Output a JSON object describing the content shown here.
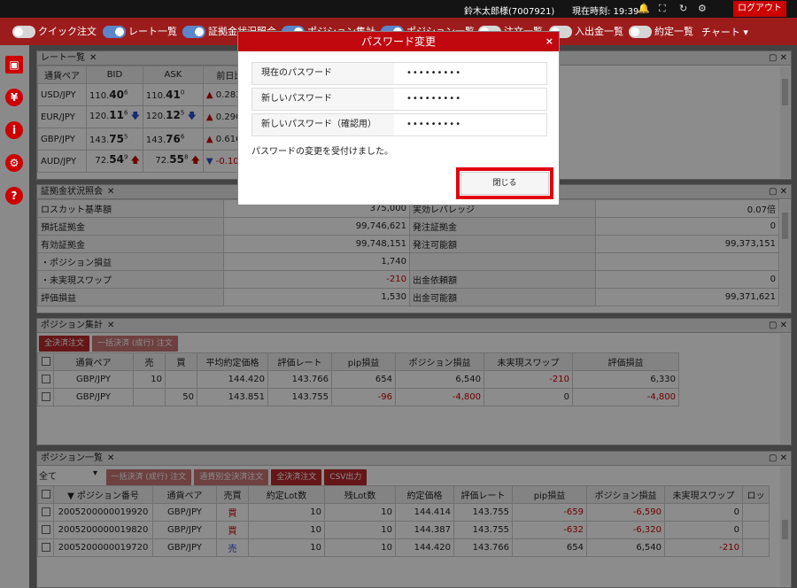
{
  "topbar": {
    "user": "鈴木太郎様(7007921)",
    "time": "現在時刻: 19:39",
    "logout": "ログアウト"
  },
  "toolbar": {
    "items": [
      "クイック注文",
      "レート一覧",
      "証拠金状況照会",
      "ポジション集計",
      "ポジション一覧",
      "注文一覧",
      "入出金一覧",
      "約定一覧"
    ],
    "chart": "チャート"
  },
  "rates": {
    "title": "レート一覧",
    "headers": [
      "通貨ペア",
      "BID",
      "ASK",
      "前日比"
    ],
    "rows": [
      {
        "pair": "USD/JPY",
        "bid_a": "110.",
        "bid_b": "40",
        "bid_c": "6",
        "ask_a": "110.",
        "ask_b": "41",
        "ask_c": "0",
        "chg": "0.283"
      },
      {
        "pair": "EUR/JPY",
        "bid_a": "120.",
        "bid_b": "11",
        "bid_c": "6",
        "ask_a": "120.",
        "ask_b": "12",
        "ask_c": "5",
        "chg": "0.290"
      },
      {
        "pair": "GBP/JPY",
        "bid_a": "143.",
        "bid_b": "75",
        "bid_c": "5",
        "ask_a": "143.",
        "ask_b": "76",
        "ask_c": "6",
        "chg": "0.616"
      },
      {
        "pair": "AUD/JPY",
        "bid_a": "72.",
        "bid_b": "54",
        "bid_c": "9",
        "ask_a": "72.",
        "ask_b": "55",
        "ask_c": "8",
        "chg": "-0.106"
      }
    ]
  },
  "margin": {
    "title": "証拠金状況照会",
    "left": [
      [
        "ロスカット基準額",
        "375,000"
      ],
      [
        "預託証拠金",
        "99,746,621"
      ],
      [
        "有効証拠金",
        "99,748,151"
      ],
      [
        "・ポジション損益",
        "1,740"
      ],
      [
        "・未実現スワップ",
        "-210"
      ],
      [
        "評価損益",
        "1,530"
      ]
    ],
    "right": [
      [
        "実効レバレッジ",
        "0.07倍"
      ],
      [
        "発注証拠金",
        "0"
      ],
      [
        "発注可能額",
        "99,373,151"
      ],
      [
        "",
        ""
      ],
      [
        "出金依頼額",
        "0"
      ],
      [
        "出金可能額",
        "99,371,621"
      ]
    ]
  },
  "summary": {
    "title": "ポジション集計",
    "btn_all": "全決済注文",
    "btn_bulk": "一括決済 (成行) 注文",
    "headers": [
      "通貨ペア",
      "売",
      "買",
      "平均約定価格",
      "評価レート",
      "pip損益",
      "ポジション損益",
      "未実現スワップ",
      "評価損益"
    ],
    "rows": [
      [
        "GBP/JPY",
        "10",
        "",
        "144.420",
        "143.766",
        "654",
        "6,540",
        "-210",
        "6,330"
      ],
      [
        "GBP/JPY",
        "",
        "50",
        "143.851",
        "143.755",
        "-96",
        "-4,800",
        "0",
        "-4,800"
      ]
    ]
  },
  "positions": {
    "title": "ポジション一覧",
    "filter": "全て",
    "btn1": "一括決済 (成行) 注文",
    "btn2": "通貨別全決済注文",
    "btn3": "全決済注文",
    "btn4": "CSV出力",
    "headers": [
      "▼ ポジション番号",
      "通貨ペア",
      "売買",
      "約定Lot数",
      "残Lot数",
      "約定価格",
      "評価レート",
      "pip損益",
      "ポジション損益",
      "未実現スワップ",
      "ロッ"
    ],
    "rows": [
      [
        "2005200000019920",
        "GBP/JPY",
        "買",
        "10",
        "10",
        "144.414",
        "143.755",
        "-659",
        "-6,590",
        "0"
      ],
      [
        "2005200000019820",
        "GBP/JPY",
        "買",
        "10",
        "10",
        "144.387",
        "143.755",
        "-632",
        "-6,320",
        "0"
      ],
      [
        "2005200000019720",
        "GBP/JPY",
        "売",
        "10",
        "10",
        "144.420",
        "143.766",
        "654",
        "6,540",
        "-210"
      ]
    ]
  },
  "modal": {
    "title": "パスワード変更",
    "fields": [
      {
        "label": "現在のパスワード",
        "value": "•••••••••"
      },
      {
        "label": "新しいパスワード",
        "value": "•••••••••"
      },
      {
        "label": "新しいパスワード（確認用）",
        "value": "•••••••••"
      }
    ],
    "message": "パスワードの変更を受付けました。",
    "close_button": "閉じる"
  }
}
